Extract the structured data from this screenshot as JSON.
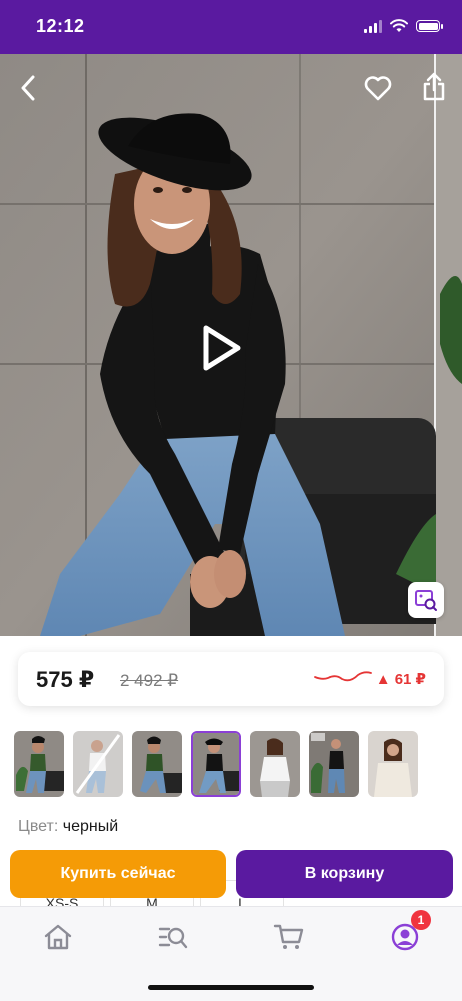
{
  "status_bar": {
    "time": "12:12"
  },
  "product": {
    "price_current": "575 ₽",
    "price_old": "2 492 ₽",
    "price_change": "▲ 61 ₽",
    "color_label": "Цвет:",
    "color_value": "черный",
    "thumbnails": [
      {
        "name": "green-top"
      },
      {
        "name": "white-top-unavailable"
      },
      {
        "name": "green-top-2"
      },
      {
        "name": "black-top"
      },
      {
        "name": "white-top"
      },
      {
        "name": "black-top-2"
      },
      {
        "name": "cream-top"
      }
    ],
    "sizes": [
      "XS-S",
      "M",
      "L"
    ]
  },
  "actions": {
    "buy_now": "Купить сейчас",
    "add_to_cart": "В корзину"
  },
  "nav": {
    "profile_badge": "1"
  },
  "colors": {
    "brand": "#5a1aa0",
    "buy": "#f59b06",
    "price_up": "#e53535"
  }
}
